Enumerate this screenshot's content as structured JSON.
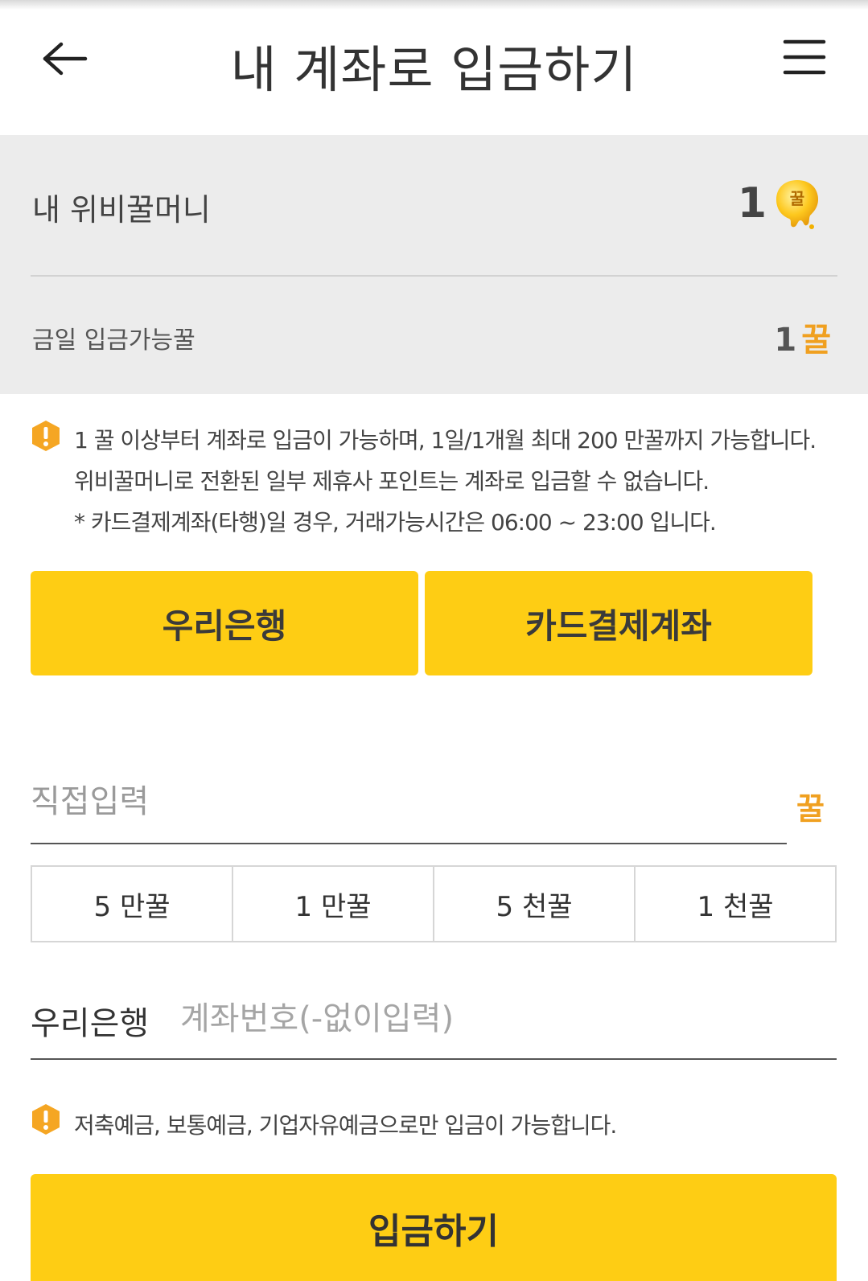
{
  "header": {
    "title": "내 계좌로 입금하기",
    "back_icon": "arrow-left-icon",
    "menu_icon": "hamburger-menu-icon"
  },
  "summary": {
    "balance_label": "내 위비꿀머니",
    "balance_value": "1",
    "balance_icon": "honey-coin-icon",
    "available_label": "금일 입금가능꿀",
    "available_value": "1",
    "available_unit": "꿀"
  },
  "notice": {
    "icon": "warning-hexagon-icon",
    "lines": [
      "1 꿀 이상부터 계좌로 입금이 가능하며, 1일/1개월 최대 200 만꿀까지 가능합니다.",
      "위비꿀머니로 전환된 일부 제휴사 포인트는 계좌로 입금할 수 없습니다.",
      "* 카드결제계좌(타행)일 경우, 거래가능시간은 06:00 ~ 23:00 입니다."
    ]
  },
  "bank_options": [
    "우리은행",
    "카드결제계좌"
  ],
  "amount": {
    "placeholder": "직접입력",
    "unit": "꿀",
    "quick_amounts": [
      "5 만꿀",
      "1 만꿀",
      "5 천꿀",
      "1 천꿀"
    ]
  },
  "account": {
    "bank_name": "우리은행",
    "placeholder": "계좌번호(-없이입력)"
  },
  "notice2": {
    "text": "저축예금, 보통예금, 기업자유예금으로만 입금이 가능합니다."
  },
  "submit_label": "입금하기",
  "colors": {
    "accent": "#fecd14",
    "honey": "#f0a020",
    "summary_bg": "#ececec",
    "warning": "#f5a623"
  }
}
